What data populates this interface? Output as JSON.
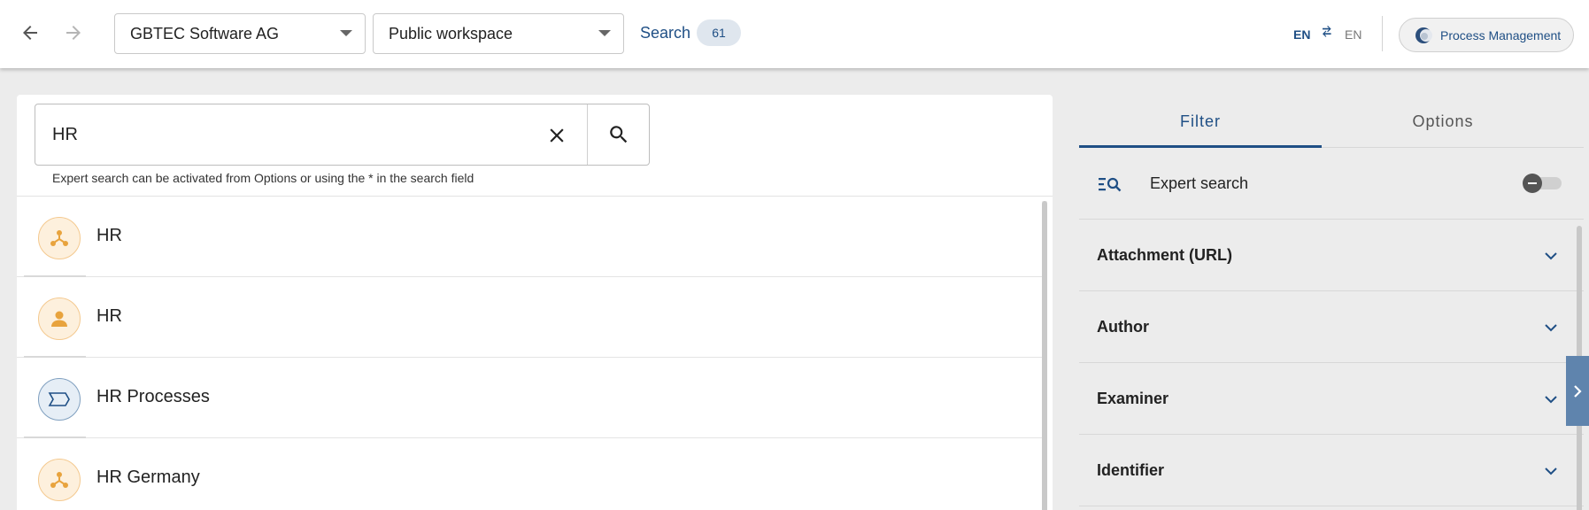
{
  "header": {
    "back_icon": "arrow-left-icon",
    "forward_icon": "arrow-right-icon",
    "organization": "GBTEC Software AG",
    "workspace": "Public workspace",
    "search_label": "Search",
    "search_count": "61",
    "lang_active": "EN",
    "lang_other": "EN",
    "app_button": "Process Management",
    "accent_color": "#1f4f85"
  },
  "search": {
    "value": "HR",
    "hint": "Expert search can be activated from Options or using the * in the search field"
  },
  "results": [
    {
      "label": "HR",
      "icon": "org-unit-icon",
      "color": "#e8a33d"
    },
    {
      "label": "HR",
      "icon": "person-icon",
      "color": "#e8a33d"
    },
    {
      "label": "HR Processes",
      "icon": "process-icon",
      "color": "#1f4f85"
    },
    {
      "label": "HR Germany",
      "icon": "org-unit-icon",
      "color": "#e8a33d"
    }
  ],
  "filter_panel": {
    "tabs": [
      {
        "label": "Filter",
        "active": true
      },
      {
        "label": "Options",
        "active": false
      }
    ],
    "expert_search_label": "Expert search",
    "expert_search_enabled": false,
    "filters": [
      {
        "label": "Attachment (URL)"
      },
      {
        "label": "Author"
      },
      {
        "label": "Examiner"
      },
      {
        "label": "Identifier"
      }
    ]
  }
}
